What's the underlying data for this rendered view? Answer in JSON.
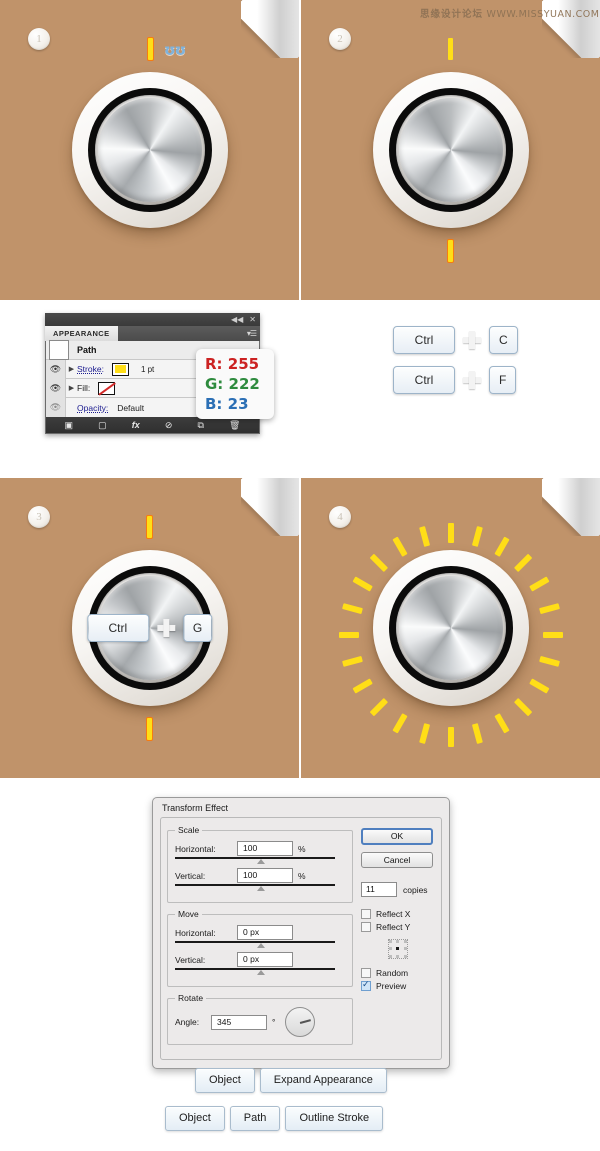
{
  "watermark": {
    "cn": "思缘设计论坛",
    "url": "WWW.MISSYUAN.COM"
  },
  "colors": {
    "canvas_bg": "#c0936a",
    "tick_yellow": "#ffde17",
    "knob_ring": "#0b0b0b",
    "page_bg": "#ffffff"
  },
  "panels": [
    {
      "step": "1",
      "caption": "knob with single yellow tick and selected anchor handles"
    },
    {
      "step": "2",
      "caption": "knob with top and bottom yellow ticks"
    },
    {
      "step": "3",
      "caption": "knob with two ticks grouped via shortcut"
    },
    {
      "step": "4",
      "caption": "knob surrounded by 24 radial yellow ticks"
    }
  ],
  "panel1": {
    "step": "1",
    "tick_label": "yellow-stroke-path",
    "anchor_glyph": "ʊʊ"
  },
  "panel2": {
    "step": "2"
  },
  "panel3": {
    "step": "3",
    "shortcut": {
      "modifier": "Ctrl",
      "plus": "+",
      "key": "G"
    }
  },
  "panel4": {
    "step": "4",
    "tick_count": 24,
    "start_angle": 0,
    "angle_step": 15
  },
  "appearance_panel": {
    "title": "APPEARANCE",
    "collapse_icon": "◀◀",
    "close_icon": "✕",
    "menu_icon": "▾☰",
    "object_name": "Path",
    "rows": [
      {
        "name": "stroke",
        "label": "Stroke:",
        "swatch": "#ffde17",
        "value": "1 pt",
        "visible": true
      },
      {
        "name": "fill",
        "label": "Fill:",
        "swatch": "none",
        "value": "",
        "visible": true
      }
    ],
    "opacity": {
      "label": "Opacity:",
      "value": "Default"
    },
    "scroll_arrow": "▾",
    "footer_icons": [
      {
        "name": "add-new-stroke-icon",
        "glyph": "▣"
      },
      {
        "name": "add-new-fill-icon",
        "glyph": "▢"
      },
      {
        "name": "add-new-effect-icon",
        "glyph": "fx"
      },
      {
        "name": "clear-appearance-icon",
        "glyph": "⊘"
      },
      {
        "name": "duplicate-item-icon",
        "glyph": "⧉"
      },
      {
        "name": "delete-item-icon",
        "glyph": "🗑"
      }
    ]
  },
  "rgb_callout": {
    "r_label": "R:",
    "r_value": "255",
    "g_label": "G:",
    "g_value": "222",
    "b_label": "B:",
    "b_value": "23"
  },
  "shortcuts": [
    {
      "modifier": "Ctrl",
      "plus": "+",
      "key": "C"
    },
    {
      "modifier": "Ctrl",
      "plus": "+",
      "key": "F"
    }
  ],
  "transform_dialog": {
    "title": "Transform Effect",
    "scale": {
      "legend": "Scale",
      "horizontal_label": "Horizontal:",
      "horizontal_value": "100",
      "horizontal_unit": "%",
      "vertical_label": "Vertical:",
      "vertical_value": "100",
      "vertical_unit": "%"
    },
    "move": {
      "legend": "Move",
      "horizontal_label": "Horizontal:",
      "horizontal_value": "0 px",
      "vertical_label": "Vertical:",
      "vertical_value": "0 px"
    },
    "rotate": {
      "legend": "Rotate",
      "angle_label": "Angle:",
      "angle_value": "345",
      "angle_unit": "°"
    },
    "ok_label": "OK",
    "cancel_label": "Cancel",
    "copies_value": "11",
    "copies_label": "copies",
    "options": [
      {
        "label": "Reflect X",
        "checked": false
      },
      {
        "label": "Reflect Y",
        "checked": false
      },
      {
        "label": "Random",
        "checked": false
      },
      {
        "label": "Preview",
        "checked": true
      }
    ]
  },
  "menu_paths": [
    {
      "items": [
        "Object",
        "Expand Appearance"
      ]
    },
    {
      "items": [
        "Object",
        "Path",
        "Outline Stroke"
      ]
    }
  ]
}
